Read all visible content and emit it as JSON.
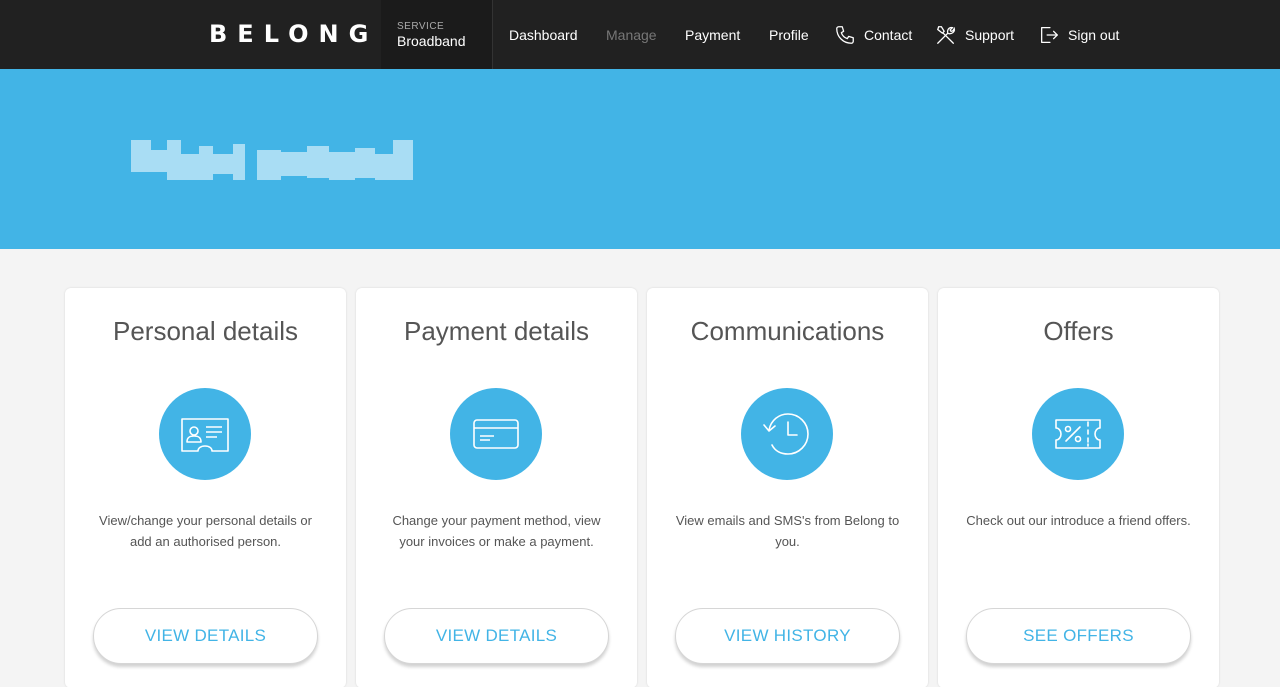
{
  "header": {
    "logo_text": "BELONG",
    "service_label": "SERVICE",
    "service_name": "Broadband",
    "nav": {
      "dashboard": "Dashboard",
      "manage": "Manage",
      "payment": "Payment",
      "profile": "Profile",
      "contact": "Contact",
      "support": "Support",
      "sign_out": "Sign out"
    },
    "icons": {
      "contact": "phone-icon",
      "support": "tools-icon",
      "sign_out": "sign-out-icon"
    }
  },
  "banner": {
    "color": "#42b4e6",
    "blurred_name": true
  },
  "cards": [
    {
      "title": "Personal details",
      "description": "View/change your personal details or add an authorised person.",
      "button": "VIEW DETAILS",
      "icon": "id-card-icon"
    },
    {
      "title": "Payment details",
      "description": "Change your payment method, view your invoices or make a payment.",
      "button": "VIEW DETAILS",
      "icon": "credit-card-icon"
    },
    {
      "title": "Communications",
      "description": "View emails and SMS's from Belong to you.",
      "button": "VIEW HISTORY",
      "icon": "history-icon"
    },
    {
      "title": "Offers",
      "description": "Check out our introduce a friend offers.",
      "button": "SEE OFFERS",
      "icon": "coupon-icon"
    }
  ],
  "colors": {
    "accent": "#42b4e6",
    "header_bg": "#212121",
    "page_bg": "#f4f4f4"
  }
}
